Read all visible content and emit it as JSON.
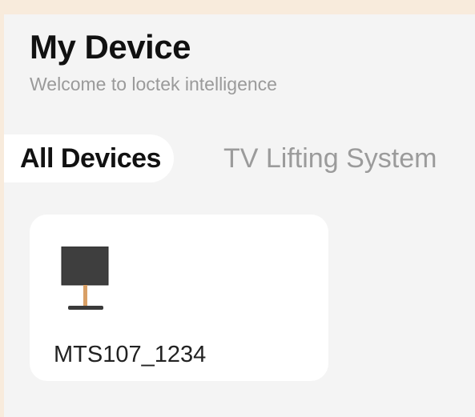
{
  "header": {
    "title": "My Device",
    "subtitle": "Welcome to loctek intelligence"
  },
  "tabs": [
    {
      "label": "All Devices",
      "active": true
    },
    {
      "label": "TV Lifting System",
      "active": false
    }
  ],
  "devices": [
    {
      "name": "MTS107_1234",
      "icon": "tv-stand-icon"
    }
  ],
  "colors": {
    "background": "#f4f4f4",
    "frame": "#f8ebdc",
    "card": "#ffffff",
    "title": "#111111",
    "muted": "#9a9a9a"
  }
}
